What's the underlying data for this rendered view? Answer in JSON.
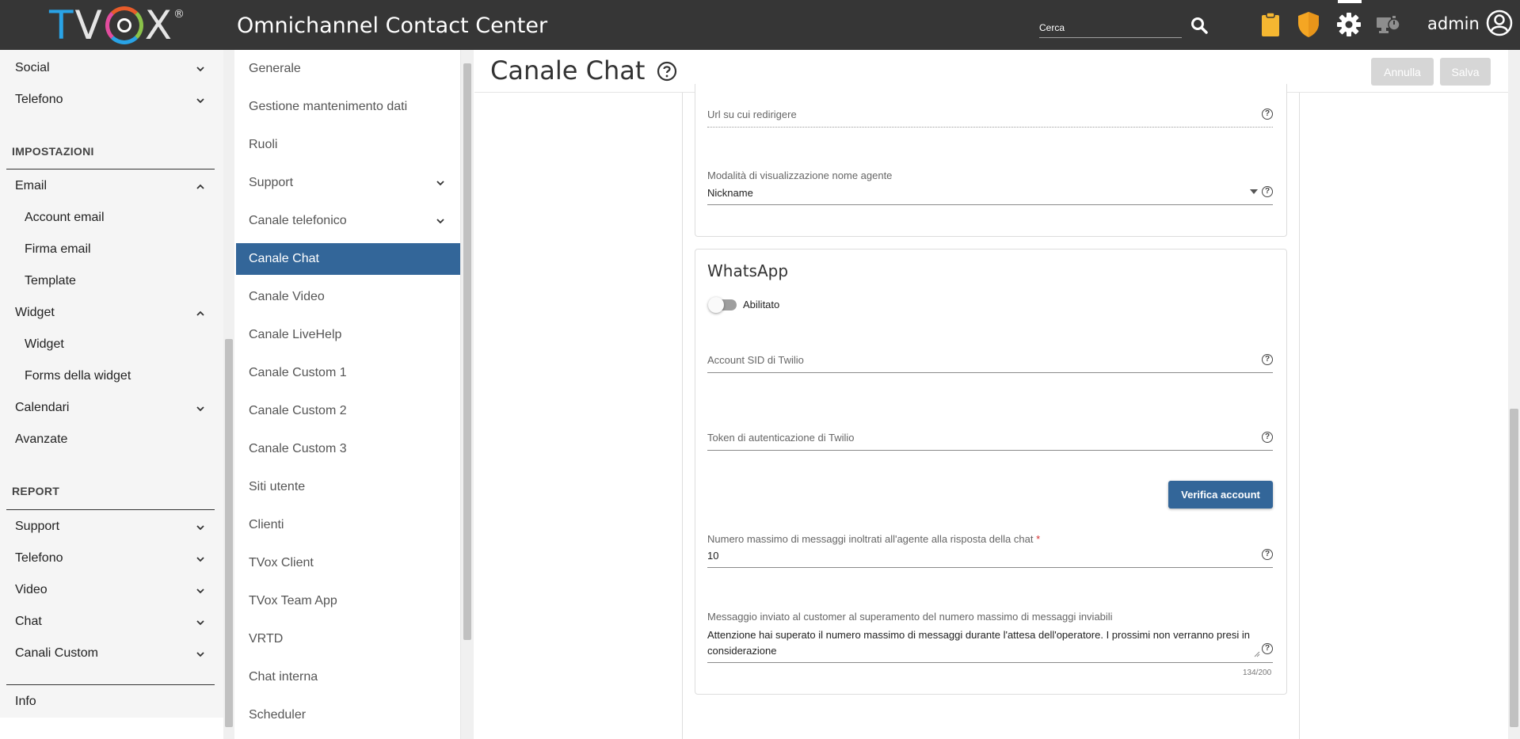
{
  "topbar": {
    "logo_letters": [
      "T",
      "V",
      "X"
    ],
    "logo_reg": "®",
    "title": "Omnichannel Contact Center",
    "search_placeholder": "Cerca",
    "user": "admin",
    "colors": {
      "bar": "#363636",
      "clipboard": "#f5b731",
      "shield": "#f5a623"
    }
  },
  "leftnav": {
    "items_top": [
      {
        "label": "Social"
      },
      {
        "label": "Telefono"
      }
    ],
    "section_impostazioni": "IMPOSTAZIONI",
    "email": "Email",
    "email_sub": [
      "Account email",
      "Firma email",
      "Template"
    ],
    "widget": "Widget",
    "widget_sub": [
      "Widget",
      "Forms della widget"
    ],
    "calendari": "Calendari",
    "avanzate": "Avanzate",
    "section_report": "REPORT",
    "report_items": [
      "Support",
      "Telefono",
      "Video",
      "Chat",
      "Canali Custom"
    ],
    "info": "Info"
  },
  "midmenu": {
    "items": [
      "Generale",
      "Gestione mantenimento dati",
      "Ruoli",
      "Support",
      "Canale telefonico",
      "Canale Chat",
      "Canale Video",
      "Canale LiveHelp",
      "Canale Custom 1",
      "Canale Custom 2",
      "Canale Custom 3",
      "Siti utente",
      "Clienti",
      "TVox Client",
      "TVox Team App",
      "VRTD",
      "Chat interna",
      "Scheduler"
    ],
    "active": "Canale Chat",
    "active_color": "#336699"
  },
  "content": {
    "title": "Canale Chat",
    "cancel": "Annulla",
    "save": "Salva",
    "url_label": "Url su cui redirigere",
    "agent_name_label": "Modalità di visualizzazione nome agente",
    "agent_name_value": "Nickname",
    "whatsapp": {
      "title": "WhatsApp",
      "enabled_label": "Abilitato",
      "sid_label": "Account SID di Twilio",
      "token_label": "Token di autenticazione di Twilio",
      "verify_button": "Verifica account",
      "max_msg_label": "Numero massimo di messaggi inoltrati all'agente alla risposta della chat",
      "required_mark": "*",
      "max_msg_value": "10",
      "exceed_label": "Messaggio inviato al customer al superamento del numero massimo di messaggi inviabili",
      "exceed_value": "Attenzione hai superato il numero massimo di messaggi durante l'attesa dell'operatore. I prossimi non verranno presi in considerazione",
      "char_count": "134/200"
    }
  }
}
